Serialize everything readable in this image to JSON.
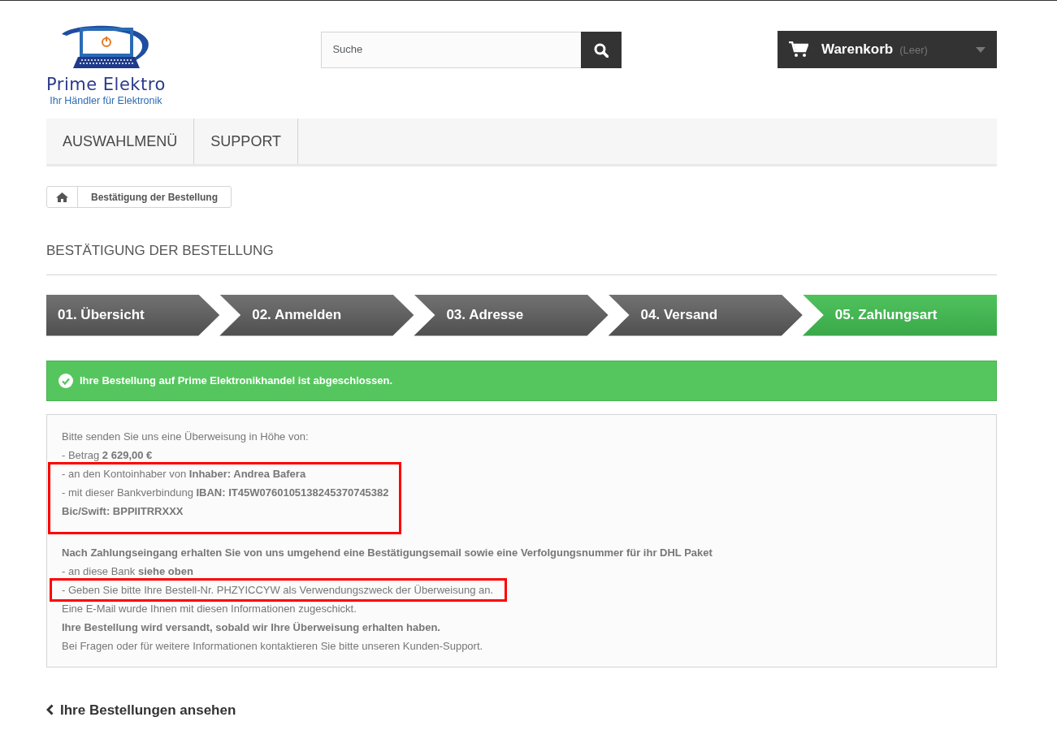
{
  "logo": {
    "name": "Prime Elektro",
    "tagline": "Ihr Händler für Elektronik"
  },
  "search": {
    "placeholder": "Suche"
  },
  "cart": {
    "label": "Warenkorb",
    "status": "(Leer)"
  },
  "menu": [
    {
      "label": "AUSWAHLMENÜ",
      "selected": false
    },
    {
      "label": "SUPPORT",
      "selected": false
    }
  ],
  "breadcrumb": [
    "Bestätigung der Bestellung"
  ],
  "page_title": "BESTÄTIGUNG DER BESTELLUNG",
  "steps": [
    {
      "label": "01. Übersicht",
      "selected": false
    },
    {
      "label": "02. Anmelden",
      "selected": false
    },
    {
      "label": "03. Adresse",
      "selected": false
    },
    {
      "label": "04. Versand",
      "selected": false
    },
    {
      "label": "05. Zahlungsart",
      "selected": true
    }
  ],
  "alert": "Ihre Bestellung auf Prime Elektronikhandel ist abgeschlossen.",
  "message": [
    {
      "highlighted": false,
      "lines": [
        {
          "text": "Bitte senden Sie uns eine Überweisung in Höhe von:",
          "bold": false
        },
        {
          "text": "- Betrag **2 629,00 €**",
          "bold": false
        }
      ]
    },
    {
      "highlighted": true,
      "lines": [
        {
          "text": "- an den Kontoinhaber von **Inhaber: Andrea Bafera**",
          "bold": false
        },
        {
          "text": "- mit dieser Bankverbindung **IBAN: IT45W0760105138245370745382**",
          "bold": false
        },
        {
          "text": "Bic/Swift: BPPIITRRXXX",
          "bold": true
        }
      ]
    },
    {
      "highlighted": false,
      "lines": [
        {
          "text": "Nach Zahlungseingang erhalten Sie von uns umgehend eine Bestätigungsemail sowie eine Verfolgungsnummer für ihr DHL Paket",
          "bold": true
        },
        {
          "text": "- an diese Bank **siehe oben**",
          "bold": false
        }
      ]
    },
    {
      "highlighted": true,
      "lines": [
        {
          "text": "- Geben Sie bitte Ihre Bestell-Nr. PHZYICCYW als Verwendungszweck der Überweisung an.",
          "bold": false
        }
      ]
    },
    {
      "highlighted": false,
      "lines": [
        {
          "text": "Eine E-Mail wurde Ihnen mit diesen Informationen zugeschickt.",
          "bold": false
        },
        {
          "text": "Ihre Bestellung wird versandt, sobald wir Ihre Überweisung erhalten haben.",
          "bold": true
        },
        {
          "text": "Bei Fragen oder für weitere Informationen kontaktieren Sie bitte unseren Kunden-Support.",
          "bold": false
        }
      ]
    }
  ],
  "back_link": "Ihre Bestellungen ansehen"
}
